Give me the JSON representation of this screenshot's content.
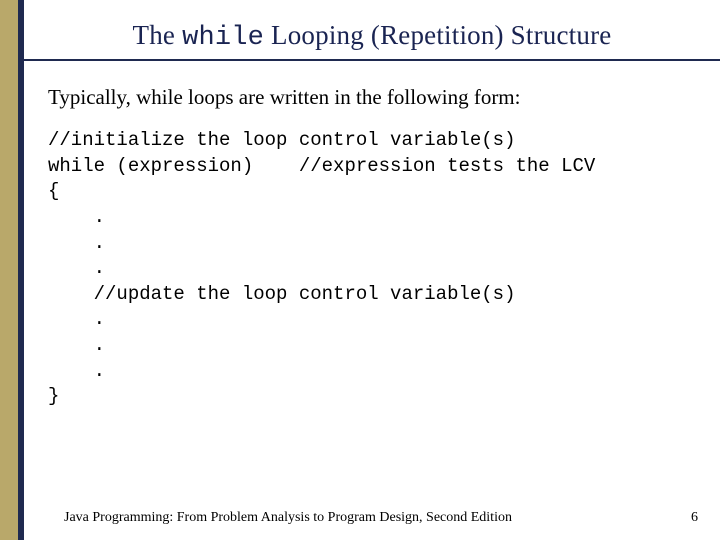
{
  "title": {
    "pre": "The ",
    "mono": "while",
    "post": " Looping (Repetition) Structure"
  },
  "intro": "Typically, while loops are written in the following form:",
  "code_lines": [
    "//initialize the loop control variable(s)",
    "while (expression)    //expression tests the LCV",
    "{",
    "    .",
    "    .",
    "    .",
    "    //update the loop control variable(s)",
    "    .",
    "    .",
    "    .",
    "}"
  ],
  "footer": "Java Programming: From Problem Analysis to Program Design, Second Edition",
  "page_number": "6"
}
